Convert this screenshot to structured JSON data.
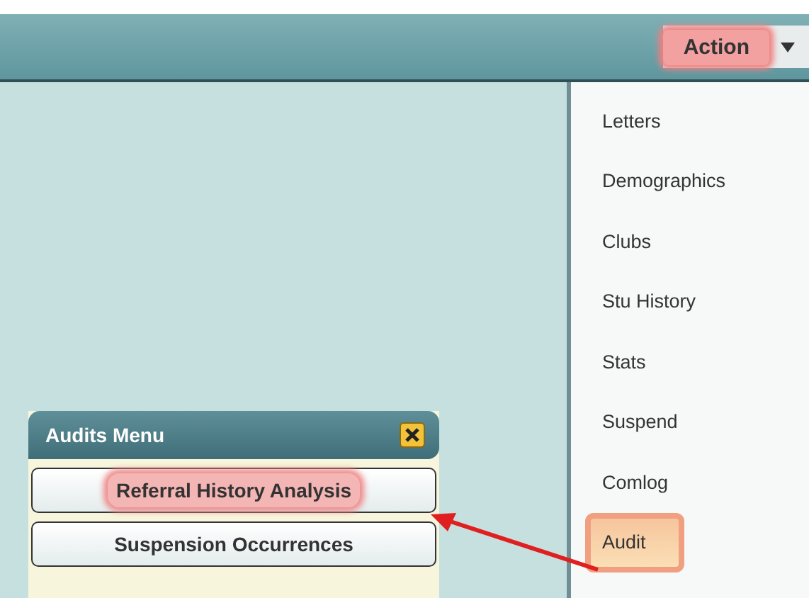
{
  "toolbar": {
    "action_button": {
      "label": "Action",
      "highlighted": true
    }
  },
  "action_menu": {
    "items": [
      {
        "label": "Letters",
        "highlighted": false
      },
      {
        "label": "Demographics",
        "highlighted": false
      },
      {
        "label": "Clubs",
        "highlighted": false
      },
      {
        "label": "Stu History",
        "highlighted": false
      },
      {
        "label": "Stats",
        "highlighted": false
      },
      {
        "label": "Suspend",
        "highlighted": false
      },
      {
        "label": "Comlog",
        "highlighted": false
      },
      {
        "label": "Audit",
        "highlighted": true
      }
    ]
  },
  "audits_menu": {
    "title": "Audits Menu",
    "items": [
      {
        "label": "Referral History Analysis",
        "highlighted": true
      },
      {
        "label": "Suspension Occurrences",
        "highlighted": false
      }
    ]
  }
}
